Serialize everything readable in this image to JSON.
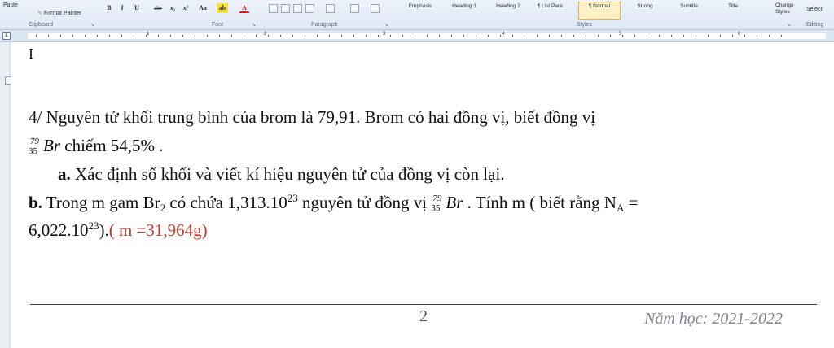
{
  "ribbon": {
    "clipboard": {
      "paste": "Paste",
      "format_painter": "Format Painter",
      "group": "Clipboard"
    },
    "font": {
      "group": "Font",
      "bold": "B",
      "italic": "I",
      "underline": "U",
      "strike": "abe",
      "sub": "x₂",
      "sup": "x²",
      "case": "Aa"
    },
    "paragraph": {
      "group": "Paragraph"
    },
    "styles": {
      "group": "Styles",
      "items": [
        "Emphasis",
        "Heading 1",
        "Heading 2",
        "¶ List Para...",
        "¶ Normal",
        "Strong",
        "Subtitle",
        "Title"
      ],
      "change": "Change Styles"
    },
    "editing": {
      "group": "Editing",
      "select": "Select"
    }
  },
  "ruler": {
    "numbers": [
      "1",
      "2",
      "3",
      "4",
      "5",
      "6"
    ]
  },
  "document": {
    "q4_line1": "4/ Nguyên tử khối trung bình của brom là 79,91. Brom có hai đồng vị, biết đồng vị",
    "q4_iso_mass": "79",
    "q4_iso_z": "35",
    "q4_iso_sym": "Br",
    "q4_line2_rest": " chiếm 54,5% .",
    "q4a_label": "a.",
    "q4a_text": "  Xác định số khối và viết kí hiệu nguyên tử của đồng vị còn lại.",
    "q4b_label": "b.",
    "q4b_text1": " Trong m gam Br",
    "q4b_sub2": "2",
    "q4b_text2": " có chứa 1,313.10",
    "q4b_sup23": "23",
    "q4b_text3": " nguyên tử đồng vị ",
    "q4b_text4": " . Tính m ( biết rằng N",
    "q4b_subA": "A",
    "q4b_text5": " =",
    "q4b_line2a": "6,022.10",
    "q4b_line2sup": "23",
    "q4b_line2b": ").",
    "q4b_answer": "( m =31,964g)",
    "page_number": "2",
    "school_year": "Năm học: 2021-2022"
  },
  "colors": {
    "answer": "#c0392b",
    "ribbon": "#dfe8f5",
    "active_style": "#fff1c7"
  }
}
